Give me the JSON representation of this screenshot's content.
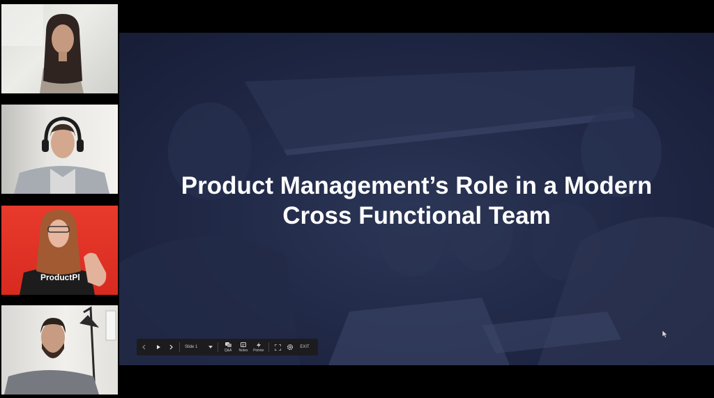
{
  "participants": [
    {
      "name": "participant-1"
    },
    {
      "name": "participant-2"
    },
    {
      "name": "participant-3",
      "shirt_text": "ProductPl"
    },
    {
      "name": "participant-4"
    }
  ],
  "slide": {
    "title_line1": "Product Management’s Role in a Modern",
    "title_line2": "Cross Functional Team"
  },
  "controls": {
    "prev_icon": "chevron-left-icon",
    "play_icon": "play-icon",
    "next_icon": "chevron-right-icon",
    "slide_select": "Slide 1",
    "qa_label": "Q&A",
    "notes_label": "Notes",
    "pointer_label": "Pointer",
    "fullscreen_icon": "fullscreen-icon",
    "settings_icon": "gear-icon",
    "exit_label": "EXIT"
  },
  "colors": {
    "slide_bg": "#1f2745",
    "controls_bg": "#1c1c1f",
    "tile3_bg": "#e0322a"
  }
}
